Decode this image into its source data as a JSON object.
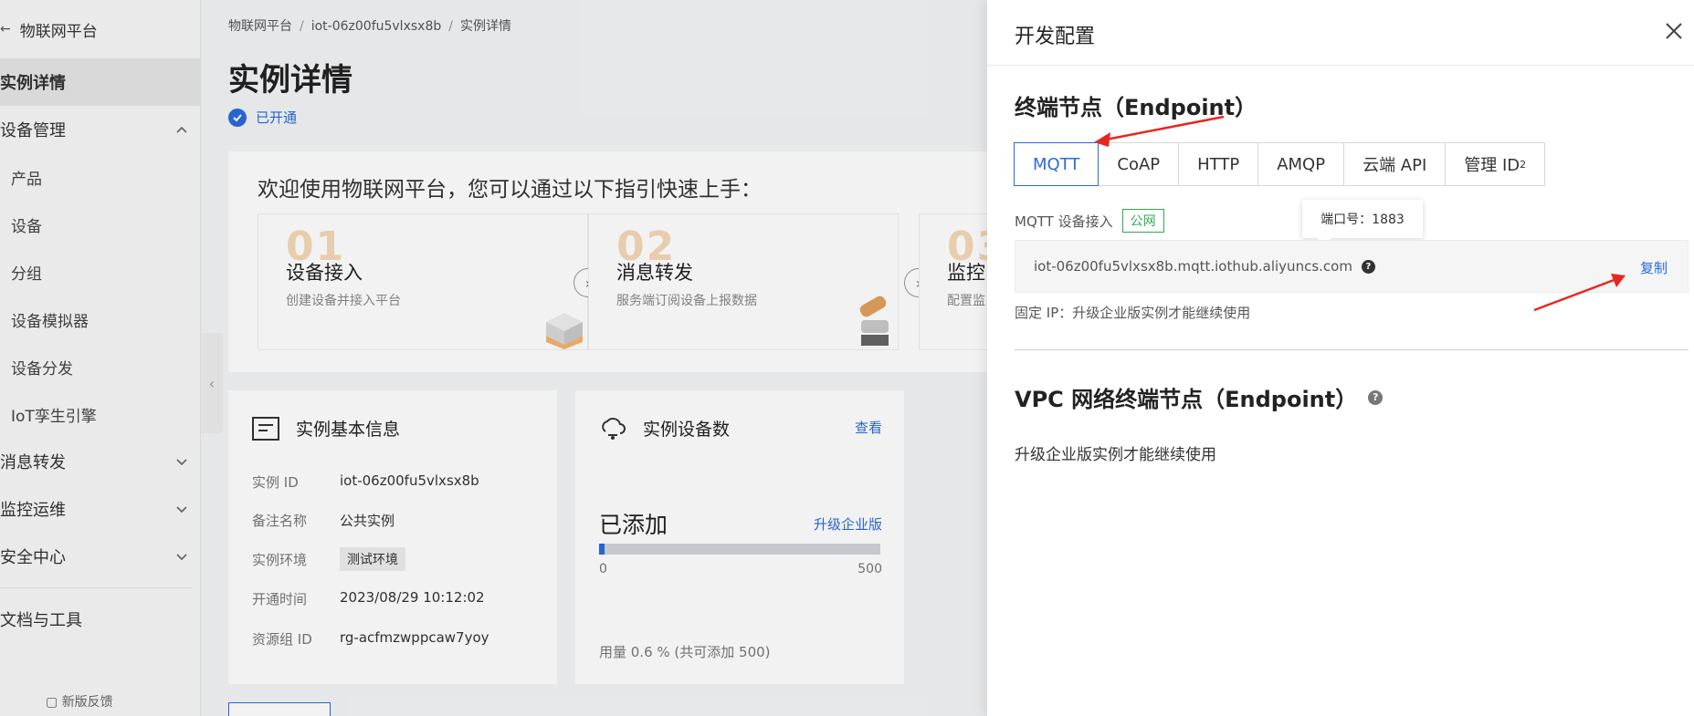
{
  "sidebar": {
    "back_label": "物联网平台",
    "items": [
      {
        "label": "实例详情",
        "active": true
      },
      {
        "label": "设备管理",
        "chevron": "up"
      },
      {
        "label": "产品",
        "sub": true
      },
      {
        "label": "设备",
        "sub": true
      },
      {
        "label": "分组",
        "sub": true
      },
      {
        "label": "设备模拟器",
        "sub": true
      },
      {
        "label": "设备分发",
        "sub": true
      },
      {
        "label": "IoT孪生引擎",
        "sub": true
      },
      {
        "label": "消息转发",
        "chevron": "down"
      },
      {
        "label": "监控运维",
        "chevron": "down"
      },
      {
        "label": "安全中心",
        "chevron": "down"
      },
      {
        "label": "文档与工具"
      }
    ],
    "footer": "新版反馈"
  },
  "breadcrumb": [
    "物联网平台",
    "iot-06z00fu5vlxsx8b",
    "实例详情"
  ],
  "page": {
    "title": "实例详情",
    "status": "已开通",
    "guide": {
      "title": "欢迎使用物联网平台，您可以通过以下指引快速上手：",
      "steps": [
        {
          "num": "01",
          "name": "设备接入",
          "desc": "创建设备并接入平台"
        },
        {
          "num": "02",
          "name": "消息转发",
          "desc": "服务端订阅设备上报数据"
        },
        {
          "num": "03",
          "name": "监控",
          "desc": "配置监"
        }
      ]
    },
    "basic_info": {
      "title": "实例基本信息",
      "rows": [
        {
          "label": "实例 ID",
          "value": "iot-06z00fu5vlxsx8b"
        },
        {
          "label": "备注名称",
          "value": "公共实例"
        },
        {
          "label": "实例环境",
          "value": "测试环境"
        },
        {
          "label": "开通时间",
          "value": "2023/08/29 10:12:02"
        },
        {
          "label": "资源组 ID",
          "value": "rg-acfmzwppcaw7yoy"
        }
      ]
    },
    "device_count": {
      "title": "实例设备数",
      "view_link": "查看",
      "added_label": "已添加",
      "upgrade_link": "升级企业版",
      "min": "0",
      "max": "500",
      "progress_fraction": 0.006,
      "usage": "用量 0.6 % (共可添加 500)"
    }
  },
  "drawer": {
    "title": "开发配置",
    "endpoint_title": "终端节点（Endpoint）",
    "tabs": [
      {
        "label": "MQTT",
        "active": true
      },
      {
        "label": "CoAP"
      },
      {
        "label": "HTTP"
      },
      {
        "label": "AMQP"
      },
      {
        "label": "云端 API"
      },
      {
        "label": "管理 ID",
        "sup": "2"
      }
    ],
    "conn_label": "MQTT 设备接入",
    "public_badge": "公网",
    "tooltip": "端口号：1883",
    "endpoint_value": "iot-06z00fu5vlxsx8b.mqtt.iothub.aliyuncs.com",
    "copy": "复制",
    "fixed_ip": "固定 IP：升级企业版实例才能继续使用",
    "vpc_title": "VPC 网络终端节点（Endpoint）",
    "vpc_note": "升级企业版实例才能继续使用"
  },
  "colors": {
    "accent": "#2a6ad9",
    "public_badge": "#34a853",
    "annotation_arrow": "#e8261f"
  }
}
